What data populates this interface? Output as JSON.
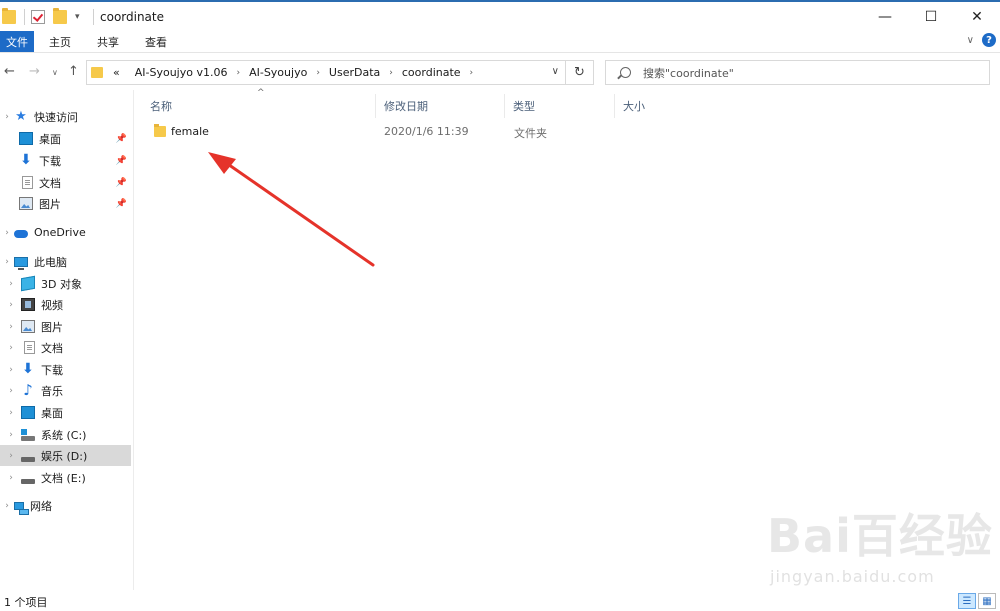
{
  "window": {
    "title": "coordinate",
    "minimize": "—",
    "maximize": "☐",
    "close": "✕"
  },
  "ribbon": {
    "tabs": [
      "文件",
      "主页",
      "共享",
      "查看"
    ],
    "help": "?"
  },
  "address": {
    "crumbs": [
      "AI-Syoujyo v1.06",
      "AI-Syoujyo",
      "UserData",
      "coordinate"
    ],
    "overflow": "«",
    "search_placeholder": "搜索\"coordinate\""
  },
  "nav": {
    "quick_access": "快速访问",
    "quick_items": [
      "桌面",
      "下载",
      "文档",
      "图片"
    ],
    "onedrive": "OneDrive",
    "this_pc": "此电脑",
    "pc_items": [
      "3D 对象",
      "视频",
      "图片",
      "文档",
      "下载",
      "音乐",
      "桌面",
      "系统 (C:)",
      "娱乐 (D:)",
      "文档 (E:)"
    ],
    "network": "网络",
    "selected": "娱乐 (D:)"
  },
  "columns": {
    "name": "名称",
    "modified": "修改日期",
    "type": "类型",
    "size": "大小"
  },
  "files": [
    {
      "name": "female",
      "modified": "2020/1/6 11:39",
      "type": "文件夹",
      "size": ""
    }
  ],
  "status": {
    "count": "1 个项目"
  },
  "watermark": {
    "main": "Bai百经验",
    "sub": "jingyan.baidu.com"
  },
  "colors": {
    "accent": "#1d6bc7",
    "arrow": "#e5332a",
    "folder": "#f6c94a"
  }
}
